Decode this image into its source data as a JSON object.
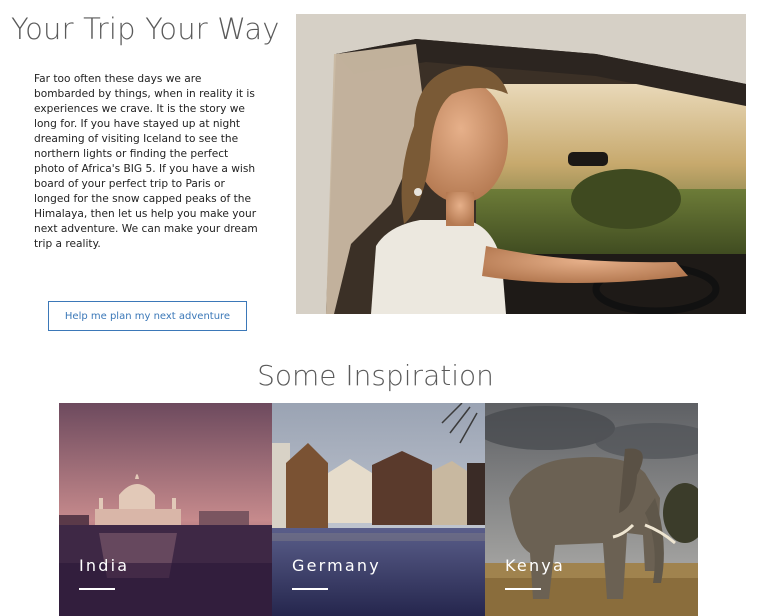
{
  "hero": {
    "title": "Your Trip Your Way",
    "body": "Far too often these days we are bombarded by things, when in reality it is experiences we crave. It is the story we long for. If you have stayed up at night dreaming of visiting Iceland to see the northern lights or finding the perfect photo of Africa's BIG 5. If you have a wish board of your perfect trip to Paris or longed for the snow capped peaks of the Himalaya, then let us help you make your next adventure. We can make your dream trip a reality.",
    "cta_label": "Help me plan my next adventure",
    "accent_color": "#3b78b8"
  },
  "inspiration": {
    "title": "Some Inspiration",
    "cards": [
      {
        "label": "India"
      },
      {
        "label": "Germany"
      },
      {
        "label": "Kenya"
      }
    ]
  }
}
